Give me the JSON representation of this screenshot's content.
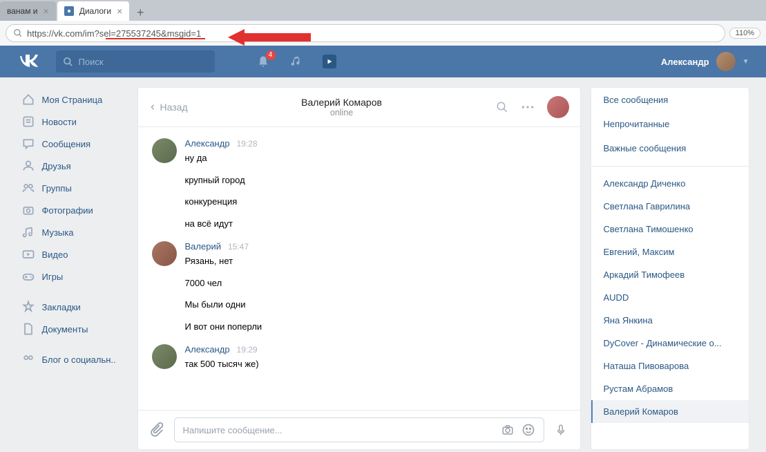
{
  "browser": {
    "tabs": [
      {
        "title": "ванам и",
        "active": false
      },
      {
        "title": "Диалоги",
        "active": true
      }
    ],
    "url": "https://vk.com/im?sel=275537245&msgid=1",
    "zoom": "110%"
  },
  "header": {
    "search_placeholder": "Поиск",
    "notification_count": "4",
    "user_name": "Александр"
  },
  "nav": {
    "items": [
      {
        "label": "Моя Страница",
        "icon": "home"
      },
      {
        "label": "Новости",
        "icon": "news"
      },
      {
        "label": "Сообщения",
        "icon": "messages"
      },
      {
        "label": "Друзья",
        "icon": "friends"
      },
      {
        "label": "Группы",
        "icon": "groups"
      },
      {
        "label": "Фотографии",
        "icon": "photos"
      },
      {
        "label": "Музыка",
        "icon": "music"
      },
      {
        "label": "Видео",
        "icon": "video"
      },
      {
        "label": "Игры",
        "icon": "games"
      }
    ],
    "secondary": [
      {
        "label": "Закладки",
        "icon": "bookmarks"
      },
      {
        "label": "Документы",
        "icon": "docs"
      }
    ],
    "tertiary": [
      {
        "label": "Блог о социальн..",
        "icon": "blog"
      }
    ]
  },
  "dialog": {
    "back": "Назад",
    "name": "Валерий Комаров",
    "status": "online",
    "messages": [
      {
        "author": "Александр",
        "time": "19:28",
        "avatar": "av1",
        "lines": [
          "ну да",
          "крупный город",
          "конкуренция",
          "на всё идут"
        ]
      },
      {
        "author": "Валерий",
        "time": "15:47",
        "avatar": "av2",
        "lines": [
          "Рязань, нет",
          "7000 чел",
          "Мы были одни",
          "И вот они поперли"
        ]
      },
      {
        "author": "Александр",
        "time": "19:29",
        "avatar": "av1",
        "lines": [
          "так 500 тысяч же)"
        ]
      }
    ],
    "composer_placeholder": "Напишите сообщение..."
  },
  "right": {
    "filters": [
      "Все сообщения",
      "Непрочитанные",
      "Важные сообщения"
    ],
    "contacts": [
      "Александр Диченко",
      "Светлана Гаврилина",
      "Светлана Тимошенко",
      "Евгений, Максим",
      "Аркадий Тимофеев",
      "AUDD",
      "Яна Янкина",
      "DyCover - Динамические о...",
      "Наташа Пивоварова",
      "Рустам Абрамов",
      "Валерий Комаров"
    ],
    "active_contact": "Валерий Комаров"
  }
}
